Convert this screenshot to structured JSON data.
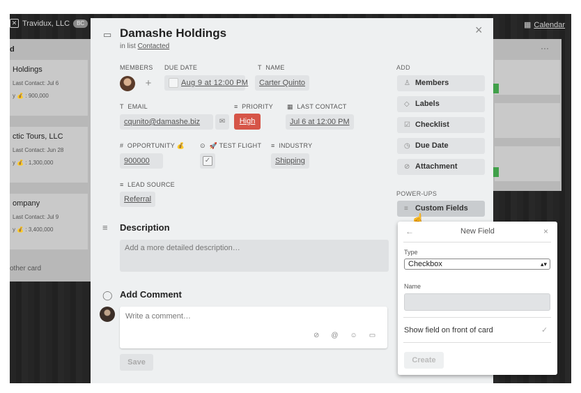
{
  "board": {
    "team_name": "Travidux, LLC",
    "team_badge": "BC",
    "calendar_label": "Calendar",
    "list_heading": "d",
    "list_menu": "···",
    "left_cards": [
      {
        "title": "Holdings",
        "last_contact": "Last Contact: Jul 6",
        "amount": "y 💰 : 900,000"
      },
      {
        "title": "ctic Tours, LLC",
        "last_contact": "Last Contact: Jun 28",
        "amount": "y 💰 : 1,300,000"
      },
      {
        "title": "ompany",
        "last_contact": "Last Contact: Jul 9",
        "amount": "y 💰 : 3,400,000"
      }
    ],
    "add_other_card": "other card"
  },
  "card": {
    "title": "Damashe Holdings",
    "in_list_prefix": "in list",
    "list_name": "Contacted",
    "close_icon": "×",
    "fields": {
      "members_label": "Members",
      "due_date_label": "Due Date",
      "due_date_value": "Aug 9 at 12:00 PM",
      "name_label": "Name",
      "name_value": "Carter Quinto",
      "email_label": "Email",
      "email_value": "cqunito@damashe.biz",
      "priority_label": "Priority",
      "priority_value": "High",
      "last_contact_label": "Last Contact",
      "last_contact_value": "Jul 6 at 12:00 PM",
      "opportunity_label": "Opportunity 💰",
      "opportunity_value": "900000",
      "test_flight_label": "🚀 Test Flight",
      "industry_label": "Industry",
      "industry_value": "Shipping",
      "lead_source_label": "Lead Source",
      "lead_source_value": "Referral"
    },
    "description": {
      "title": "Description",
      "placeholder": "Add a more detailed description…"
    },
    "comment": {
      "title": "Add Comment",
      "placeholder": "Write a comment…",
      "save_label": "Save"
    }
  },
  "sidebar": {
    "add_heading": "Add",
    "add_buttons": [
      {
        "label": "Members",
        "icon": "person-icon"
      },
      {
        "label": "Labels",
        "icon": "tag-icon"
      },
      {
        "label": "Checklist",
        "icon": "checklist-icon"
      },
      {
        "label": "Due Date",
        "icon": "clock-icon"
      },
      {
        "label": "Attachment",
        "icon": "paperclip-icon"
      }
    ],
    "powerups_heading": "Power-Ups",
    "custom_fields_label": "Custom Fields"
  },
  "new_field_popover": {
    "title": "New Field",
    "back_icon": "←",
    "close_icon": "×",
    "type_label": "Type",
    "type_value": "Checkbox",
    "name_label": "Name",
    "name_value": "",
    "show_on_front_label": "Show field on front of card",
    "create_label": "Create"
  }
}
